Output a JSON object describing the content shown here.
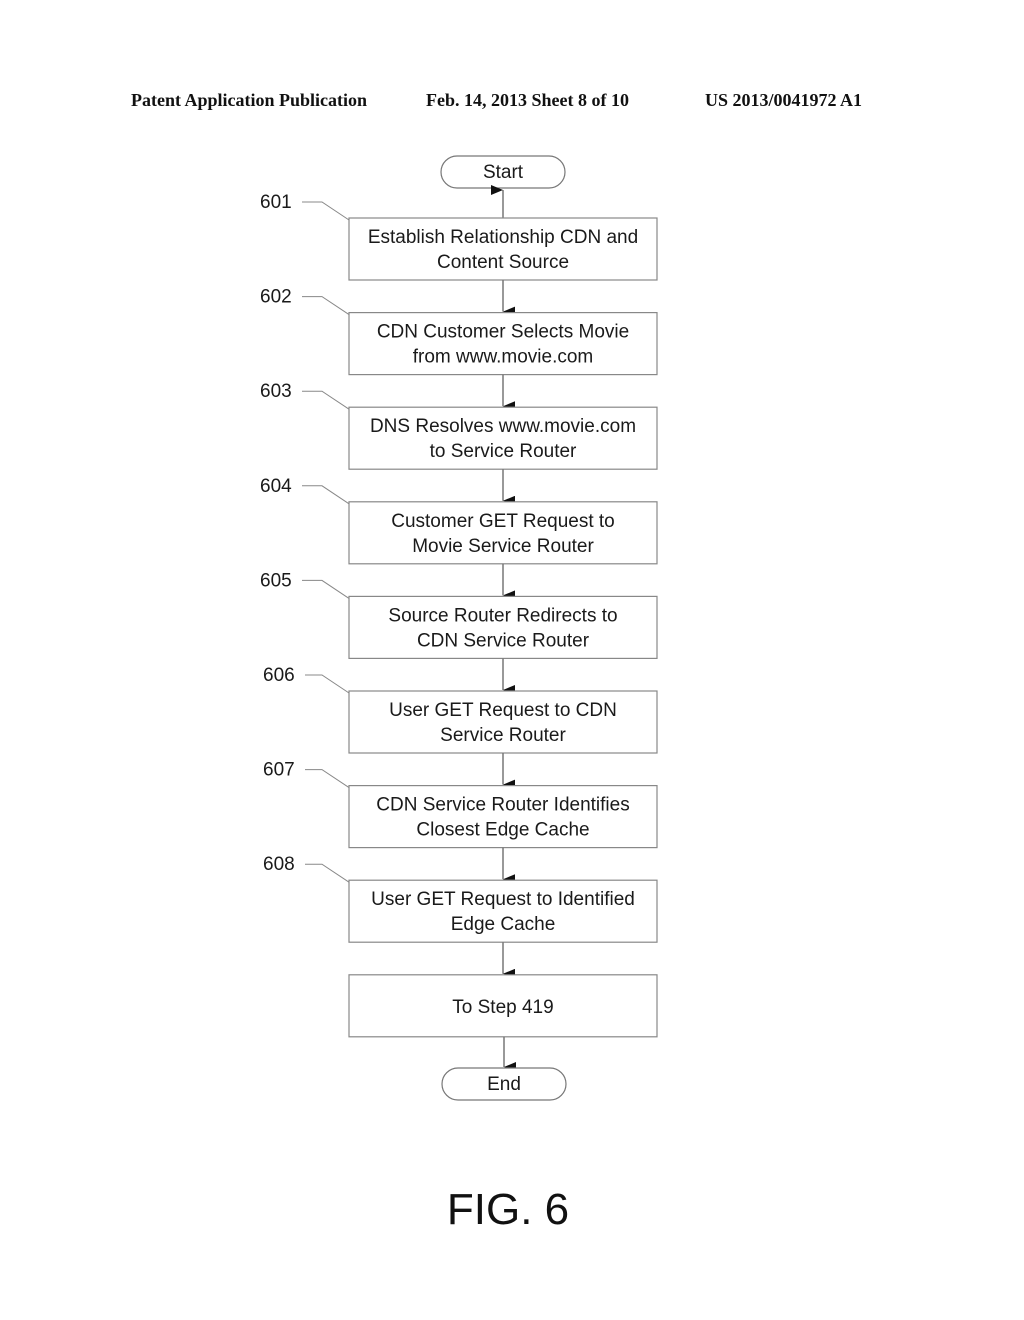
{
  "header": {
    "publication": "Patent Application Publication",
    "date_sheet": "Feb. 14, 2013   Sheet 8 of 10",
    "number": "US 2013/0041972 A1"
  },
  "flowchart": {
    "start_label": "Start",
    "end_label": "End",
    "steps": [
      {
        "ref": "601",
        "lines": [
          "Establish Relationship CDN and",
          "Content Source"
        ]
      },
      {
        "ref": "602",
        "lines": [
          "CDN Customer Selects Movie",
          "from www.movie.com"
        ]
      },
      {
        "ref": "603",
        "lines": [
          "DNS Resolves www.movie.com",
          "to Service Router"
        ]
      },
      {
        "ref": "604",
        "lines": [
          "Customer GET Request to",
          "Movie Service Router"
        ]
      },
      {
        "ref": "605",
        "lines": [
          "Source Router Redirects to",
          "CDN Service Router"
        ]
      },
      {
        "ref": "606",
        "lines": [
          "User GET Request to CDN",
          "Service Router"
        ]
      },
      {
        "ref": "607",
        "lines": [
          "CDN Service Router Identifies",
          "Closest Edge Cache"
        ]
      },
      {
        "ref": "608",
        "lines": [
          "User GET Request to Identified",
          "Edge Cache"
        ]
      },
      {
        "ref": "",
        "lines": [
          "To Step 419"
        ]
      }
    ]
  },
  "figure_label": "FIG. 6"
}
